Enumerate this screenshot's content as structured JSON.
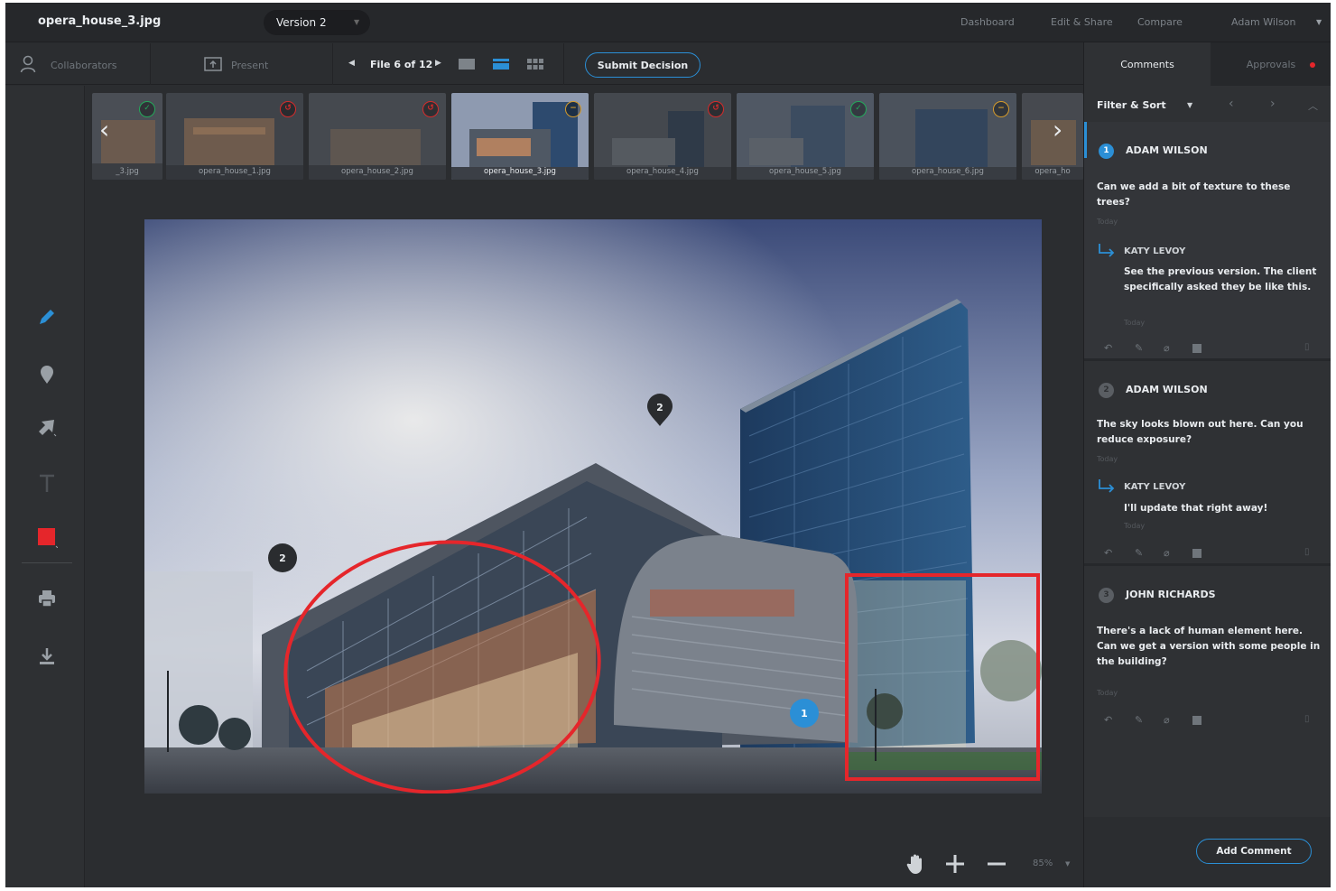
{
  "header": {
    "file_name": "opera_house_3.jpg",
    "version_label": "Version 2",
    "nav": [
      "Dashboard",
      "Edit & Share",
      "Compare"
    ],
    "user_name": "Adam Wilson"
  },
  "toolbar": {
    "collaborators_label": "Collaborators",
    "present_label": "Present",
    "file_position": "File 6 of 12",
    "view_modes": [
      "single-view",
      "filmstrip-view",
      "grid-view"
    ],
    "active_view": "filmstrip-view",
    "submit_label": "Submit Decision"
  },
  "filmstrip": {
    "items": [
      {
        "caption": "_3.jpg",
        "status": "approved"
      },
      {
        "caption": "opera_house_1.jpg",
        "status": "rejected"
      },
      {
        "caption": "opera_house_2.jpg",
        "status": "rejected"
      },
      {
        "caption": "opera_house_3.jpg",
        "status": "pending",
        "selected": true
      },
      {
        "caption": "opera_house_4.jpg",
        "status": "rejected"
      },
      {
        "caption": "opera_house_5.jpg",
        "status": "approved"
      },
      {
        "caption": "opera_house_6.jpg",
        "status": "pending"
      },
      {
        "caption": "opera_ho",
        "status": "none"
      }
    ],
    "status_colors": {
      "approved": "#23a85a",
      "rejected": "#d62b2b",
      "pending": "#d59b2b"
    }
  },
  "tools": [
    "pencil-icon",
    "pin-icon",
    "arrow-icon",
    "text-icon",
    "color-swatch",
    "print-icon",
    "download-icon"
  ],
  "active_color": "#e5262b",
  "canvas": {
    "pins": [
      {
        "label": "2"
      },
      {
        "label": "2"
      },
      {
        "label": "1"
      }
    ],
    "zoom": "85%"
  },
  "panel": {
    "tabs": {
      "comments": "Comments",
      "approvals": "Approvals"
    },
    "filter_label": "Filter & Sort",
    "comments": [
      {
        "number": "1",
        "author": "ADAM WILSON",
        "text": "Can we add a bit of texture to these trees?",
        "time": "Today",
        "reply": {
          "author": "KATY LEVOY",
          "text": "See the previous version. The client specifically asked they be like this.",
          "time": "Today"
        }
      },
      {
        "number": "2",
        "author": "ADAM WILSON",
        "text": "The sky looks blown out here. Can you reduce exposure?",
        "time": "Today",
        "reply": {
          "author": "KATY LEVOY",
          "text": "I'll update that right away!",
          "time": "Today"
        }
      },
      {
        "number": "3",
        "author": "JOHN RICHARDS",
        "text": "There's a lack of human element here. Can we get a version with some people in the building?",
        "time": "Today"
      }
    ],
    "add_comment_label": "Add Comment"
  },
  "accent_color": "#2b8fd6"
}
